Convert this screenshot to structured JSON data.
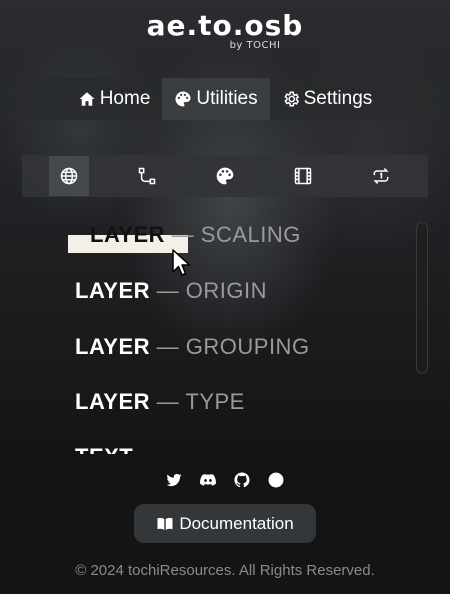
{
  "header": {
    "logo": "ae.to.osb",
    "byline": "by TOCHI"
  },
  "nav": {
    "items": [
      {
        "label": "Home",
        "icon": "home-icon"
      },
      {
        "label": "Utilities",
        "icon": "palette-icon",
        "active": true
      },
      {
        "label": "Settings",
        "icon": "gear-icon"
      }
    ]
  },
  "toolbar": {
    "tools": [
      "globe-icon",
      "vector-path-icon",
      "palette-icon",
      "film-icon",
      "repeat-icon"
    ],
    "active": "globe-icon"
  },
  "list": {
    "items": [
      {
        "strong": "LAYER",
        "soft": " — SCALING"
      },
      {
        "strong": "LAYER",
        "soft": " — ORIGIN"
      },
      {
        "strong": "LAYER",
        "soft": " — GROUPING"
      },
      {
        "strong": "LAYER",
        "soft": " — TYPE"
      },
      {
        "strong": "TEXT",
        "soft": ""
      }
    ]
  },
  "social": [
    "twitter-icon",
    "discord-icon",
    "github-icon",
    "globe-icon"
  ],
  "doc_button": {
    "label": "Documentation",
    "icon": "book-icon"
  },
  "footer": {
    "copyright": "© 2024 tochiResources. All Rights Reserved."
  },
  "colors": {
    "accent": "#34373a",
    "text": "#ffffff",
    "muted": "#9a9a9a"
  }
}
